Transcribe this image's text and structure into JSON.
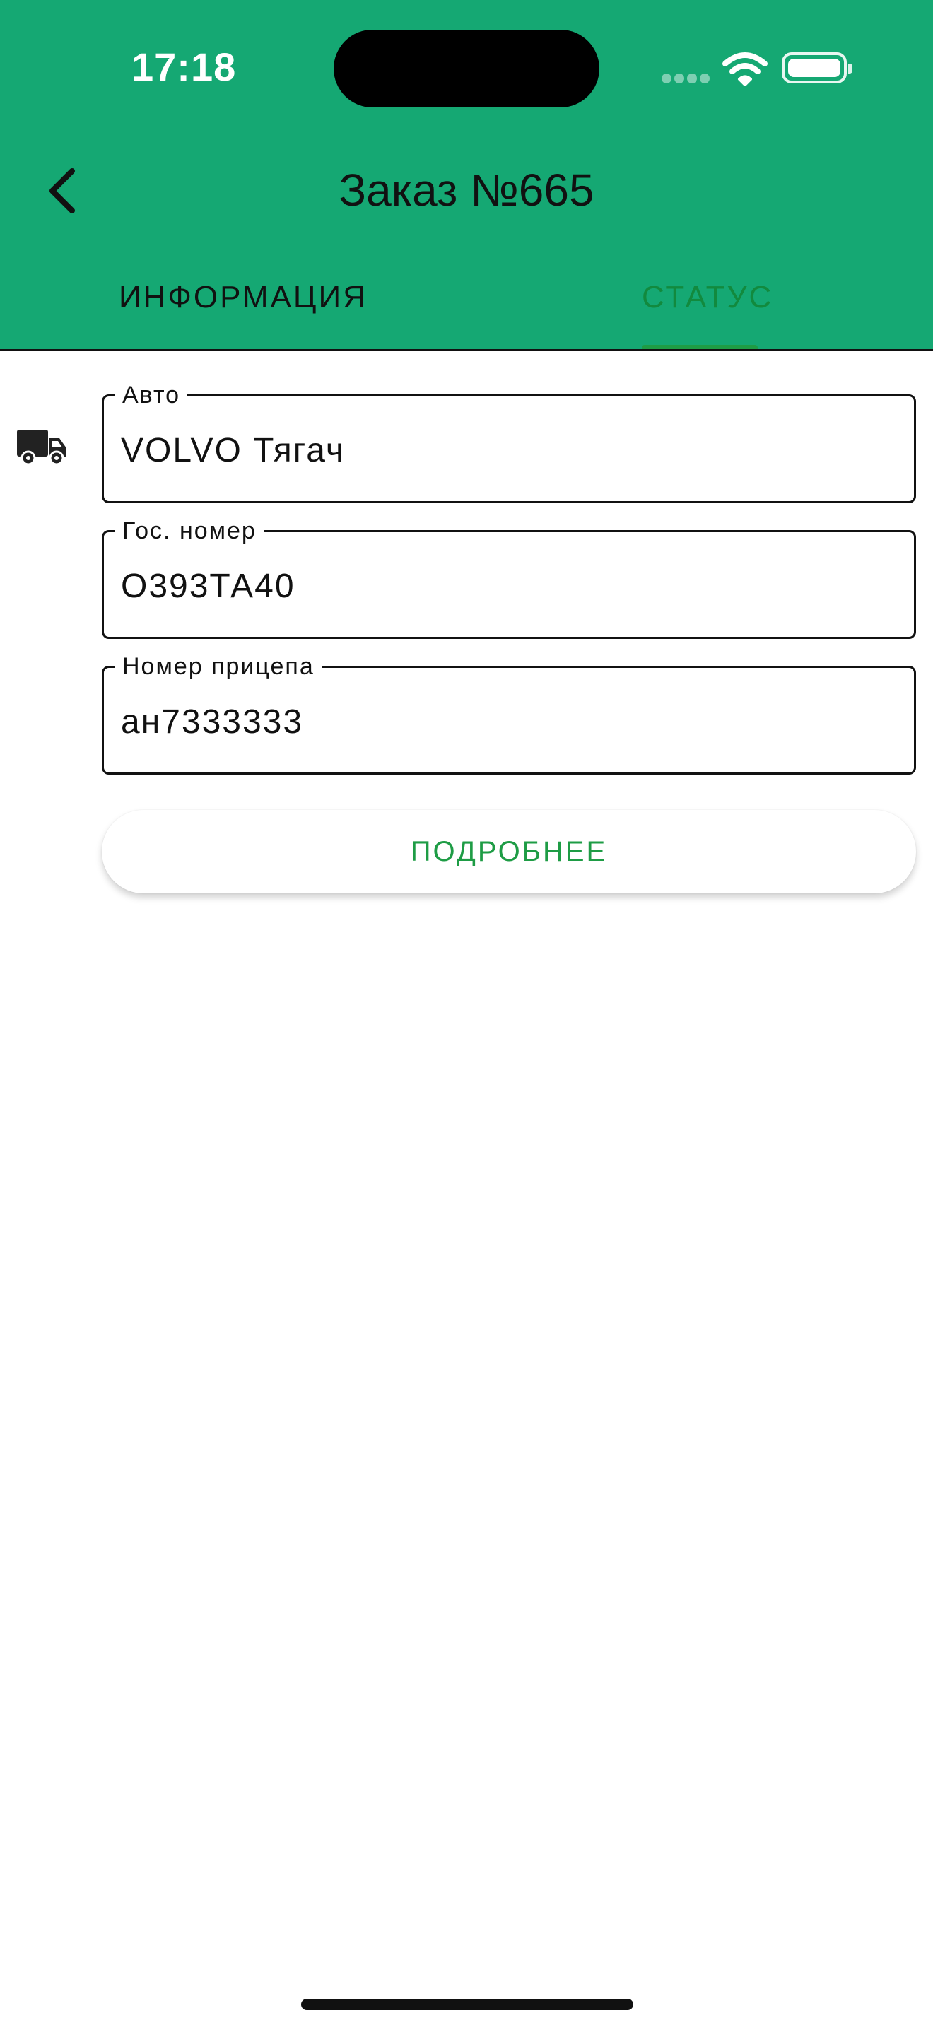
{
  "status_bar": {
    "time": "17:18",
    "icons": [
      "cellular-signal-icon",
      "wifi-icon",
      "battery-icon"
    ]
  },
  "header": {
    "title": "Заказ №665",
    "back_icon": "chevron-left-icon"
  },
  "tabs": [
    {
      "label": "ИНФОРМАЦИЯ",
      "selected": false
    },
    {
      "label": "СТАТУС",
      "selected": true
    }
  ],
  "vehicle": {
    "icon": "truck-icon",
    "fields": [
      {
        "label": "Авто",
        "value": "VOLVO Тягач"
      },
      {
        "label": "Гос. номер",
        "value": "О393ТА40"
      },
      {
        "label": "Номер прицепа",
        "value": "ан7333333"
      }
    ]
  },
  "actions": {
    "more_label": "ПОДРОБНЕЕ"
  },
  "colors": {
    "header_bg": "#15a873",
    "accent_green": "#1e9c45",
    "selected_tab_text": "#128a3e"
  }
}
